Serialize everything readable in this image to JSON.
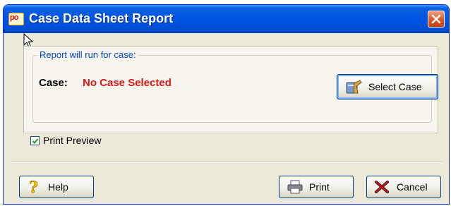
{
  "window": {
    "title": "Case Data Sheet Report",
    "app_icon_text": "po",
    "close_icon": "close-icon"
  },
  "group": {
    "legend": "Report will run for case:",
    "case_label": "Case:",
    "case_value": "No Case Selected",
    "case_value_color": "#e01818"
  },
  "buttons": {
    "select_case": {
      "label": "Select Case",
      "icon": "select-case-icon"
    },
    "help": {
      "label": "Help",
      "icon": "help-icon"
    },
    "print": {
      "label": "Print",
      "icon": "printer-icon"
    },
    "cancel": {
      "label": "Cancel",
      "icon": "cancel-icon"
    }
  },
  "print_preview": {
    "label": "Print Preview",
    "checked": true
  },
  "colors": {
    "titlebar": "#0054e3",
    "window_bg": "#ece9d8",
    "legend_text": "#0046d5"
  }
}
